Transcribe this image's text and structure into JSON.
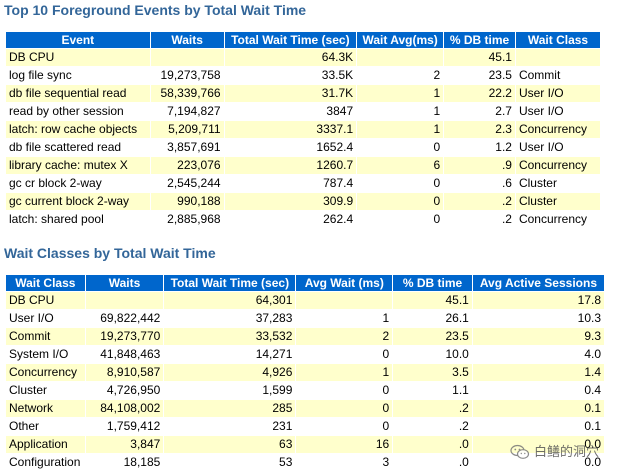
{
  "table1": {
    "title": "Top 10 Foreground Events by Total Wait Time",
    "headers": [
      "Event",
      "Waits",
      "Total Wait Time (sec)",
      "Wait Avg(ms)",
      "% DB time",
      "Wait Class"
    ],
    "rows": [
      [
        "DB CPU",
        "",
        "64.3K",
        "",
        "45.1",
        ""
      ],
      [
        "log file sync",
        "19,273,758",
        "33.5K",
        "2",
        "23.5",
        "Commit"
      ],
      [
        "db file sequential read",
        "58,339,766",
        "31.7K",
        "1",
        "22.2",
        "User I/O"
      ],
      [
        "read by other session",
        "7,194,827",
        "3847",
        "1",
        "2.7",
        "User I/O"
      ],
      [
        "latch: row cache objects",
        "5,209,711",
        "3337.1",
        "1",
        "2.3",
        "Concurrency"
      ],
      [
        "db file scattered read",
        "3,857,691",
        "1652.4",
        "0",
        "1.2",
        "User I/O"
      ],
      [
        "library cache: mutex X",
        "223,076",
        "1260.7",
        "6",
        ".9",
        "Concurrency"
      ],
      [
        "gc cr block 2-way",
        "2,545,244",
        "787.4",
        "0",
        ".6",
        "Cluster"
      ],
      [
        "gc current block 2-way",
        "990,188",
        "309.9",
        "0",
        ".2",
        "Cluster"
      ],
      [
        "latch: shared pool",
        "2,885,968",
        "262.4",
        "0",
        ".2",
        "Concurrency"
      ]
    ]
  },
  "table2": {
    "title": "Wait Classes by Total Wait Time",
    "headers": [
      "Wait Class",
      "Waits",
      "Total Wait Time (sec)",
      "Avg Wait (ms)",
      "% DB time",
      "Avg Active Sessions"
    ],
    "rows": [
      [
        "DB CPU",
        "",
        "64,301",
        "",
        "45.1",
        "17.8"
      ],
      [
        "User I/O",
        "69,822,442",
        "37,283",
        "1",
        "26.1",
        "10.3"
      ],
      [
        "Commit",
        "19,273,770",
        "33,532",
        "2",
        "23.5",
        "9.3"
      ],
      [
        "System I/O",
        "41,848,463",
        "14,271",
        "0",
        "10.0",
        "4.0"
      ],
      [
        "Concurrency",
        "8,910,587",
        "4,926",
        "1",
        "3.5",
        "1.4"
      ],
      [
        "Cluster",
        "4,726,950",
        "1,599",
        "0",
        "1.1",
        "0.4"
      ],
      [
        "Network",
        "84,108,002",
        "285",
        "0",
        ".2",
        "0.1"
      ],
      [
        "Other",
        "1,759,412",
        "231",
        "0",
        ".2",
        "0.1"
      ],
      [
        "Application",
        "3,847",
        "63",
        "16",
        ".0",
        "0.0"
      ],
      [
        "Configuration",
        "18,185",
        "53",
        "3",
        ".0",
        "0.0"
      ]
    ]
  },
  "watermark": {
    "text": "白鳝的洞穴",
    "icon": "wechat-icon"
  },
  "colors": {
    "title": "#336699",
    "header_bg": "#0066cc",
    "header_fg": "#ffffff",
    "odd_row": "#ffffcc",
    "even_row": "#ffffff"
  }
}
